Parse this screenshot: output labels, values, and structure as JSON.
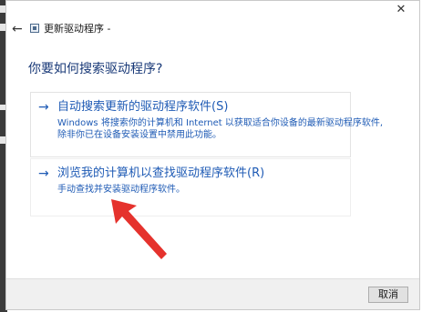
{
  "titlebar": {
    "back_icon": "back-arrow-icon",
    "app_icon": "device-driver-icon",
    "title": "更新驱动程序 -"
  },
  "window": {
    "close_icon": "close-icon",
    "close_glyph": "✕"
  },
  "heading": "你要如何搜索驱动程序?",
  "options": [
    {
      "arrow": "→",
      "title": "自动搜索更新的驱动程序软件(S)",
      "desc_line1": "Windows 将搜索你的计算机和 Internet 以获取适合你设备的最新驱动程序软件,",
      "desc_line2": "除非你已在设备安装设置中禁用此功能。"
    },
    {
      "arrow": "→",
      "title": "浏览我的计算机以查找驱动程序软件(R)",
      "desc_line1": "手动查找并安装驱动程序软件。"
    }
  ],
  "footer": {
    "cancel_label": "取消"
  },
  "colors": {
    "link_blue": "#1f5bb5",
    "heading_blue": "#1a3a78",
    "annotation_red": "#e5322d"
  }
}
